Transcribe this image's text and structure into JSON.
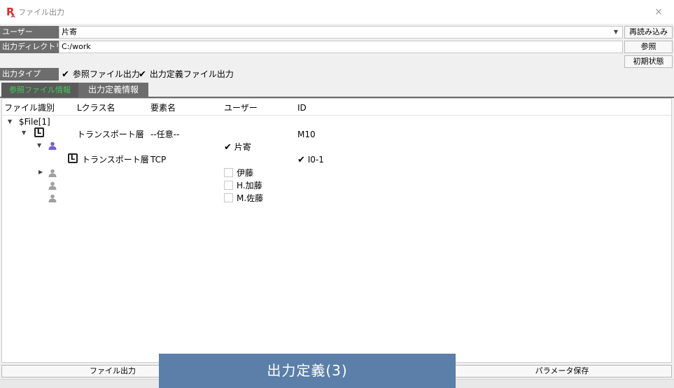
{
  "window": {
    "title": "ファイル出力",
    "logo": "R",
    "logo_sub": "A",
    "close": "×"
  },
  "header": {
    "user_label": "ユーザー",
    "user_value": "片寄",
    "reload_label": "再読み込み",
    "dir_label": "出力ディレクトリ",
    "dir_value": "C:/work",
    "browse_label": "参照",
    "init_label": "初期状態",
    "type_label": "出力タイプ",
    "type_ref_checked": true,
    "type_ref_label": "参照ファイル出力",
    "type_def_checked": true,
    "type_def_label": "出力定義ファイル出力"
  },
  "tabs": [
    {
      "label": "参照ファイル情報",
      "active": true
    },
    {
      "label": "出力定義情報",
      "active": false
    }
  ],
  "tree": {
    "columns": [
      "ファイル識別",
      "Lクラス名",
      "要素名",
      "ユーザー",
      "ID"
    ],
    "root": "$File[1]",
    "row1": {
      "lclass": "トランスポート層",
      "element": "--任意--",
      "id": "M10"
    },
    "user1": {
      "name": "片寄",
      "checked": true
    },
    "row2": {
      "lclass": "トランスポート層",
      "element": "TCP",
      "id": "I0-1",
      "id_checked": true
    },
    "users": [
      {
        "name": "伊藤",
        "checked": false
      },
      {
        "name": "H.加藤",
        "checked": false
      },
      {
        "name": "M.佐藤",
        "checked": false
      }
    ],
    "icons": {
      "active_user_color": "#7b5fc9",
      "inactive_user_color": "#a0a0a0"
    }
  },
  "bottom": {
    "file_output_label": "ファイル出力",
    "param_save_label": "パラメータ保存",
    "banner": "出力定義(3)"
  }
}
